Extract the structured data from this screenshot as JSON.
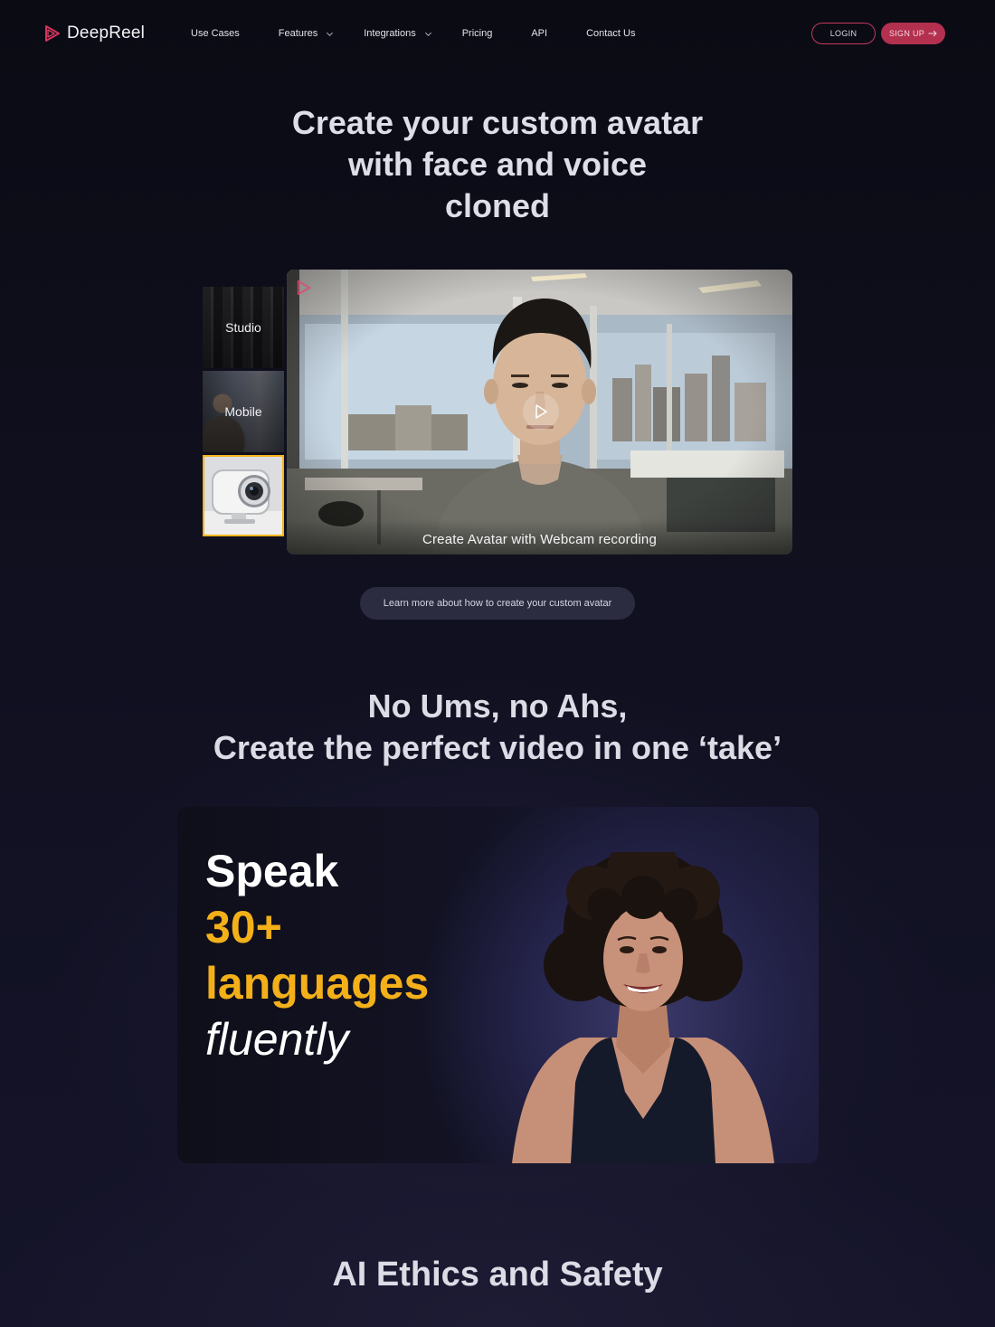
{
  "nav": {
    "logo_text": "DeepReel",
    "links": [
      {
        "label": "Use Cases",
        "has_dropdown": false
      },
      {
        "label": "Features",
        "has_dropdown": true
      },
      {
        "label": "Integrations",
        "has_dropdown": true
      },
      {
        "label": "Pricing",
        "has_dropdown": false
      },
      {
        "label": "API",
        "has_dropdown": false
      },
      {
        "label": "Contact Us",
        "has_dropdown": false
      }
    ],
    "login_label": "LOGIN",
    "signup_label": "SIGN UP",
    "signup_icon": "arrow-right-icon"
  },
  "hero": {
    "title_lines": [
      "Create your custom avatar",
      "with face and voice",
      "cloned"
    ]
  },
  "avatar_demo": {
    "tabs": [
      {
        "label": "Studio",
        "active": false
      },
      {
        "label": "Mobile",
        "active": false
      },
      {
        "label": "",
        "icon": "webcam-icon",
        "active": true
      }
    ],
    "video_caption": "Create Avatar with Webcam recording",
    "play_icon": "play-icon",
    "learn_more_label": "Learn more about how to create your custom avatar"
  },
  "takes_section": {
    "title_lines": [
      "No Ums, no Ahs,",
      "Create the perfect video in one ‘take’"
    ]
  },
  "languages_card": {
    "line1": "Speak",
    "line2": "30+",
    "line3": "languages",
    "line4": "fluently"
  },
  "ethics_section": {
    "title": "AI Ethics and Safety"
  },
  "colors": {
    "brand_accent": "#b3304f",
    "highlight_yellow": "#f3b019",
    "background": "#0b0b14"
  }
}
